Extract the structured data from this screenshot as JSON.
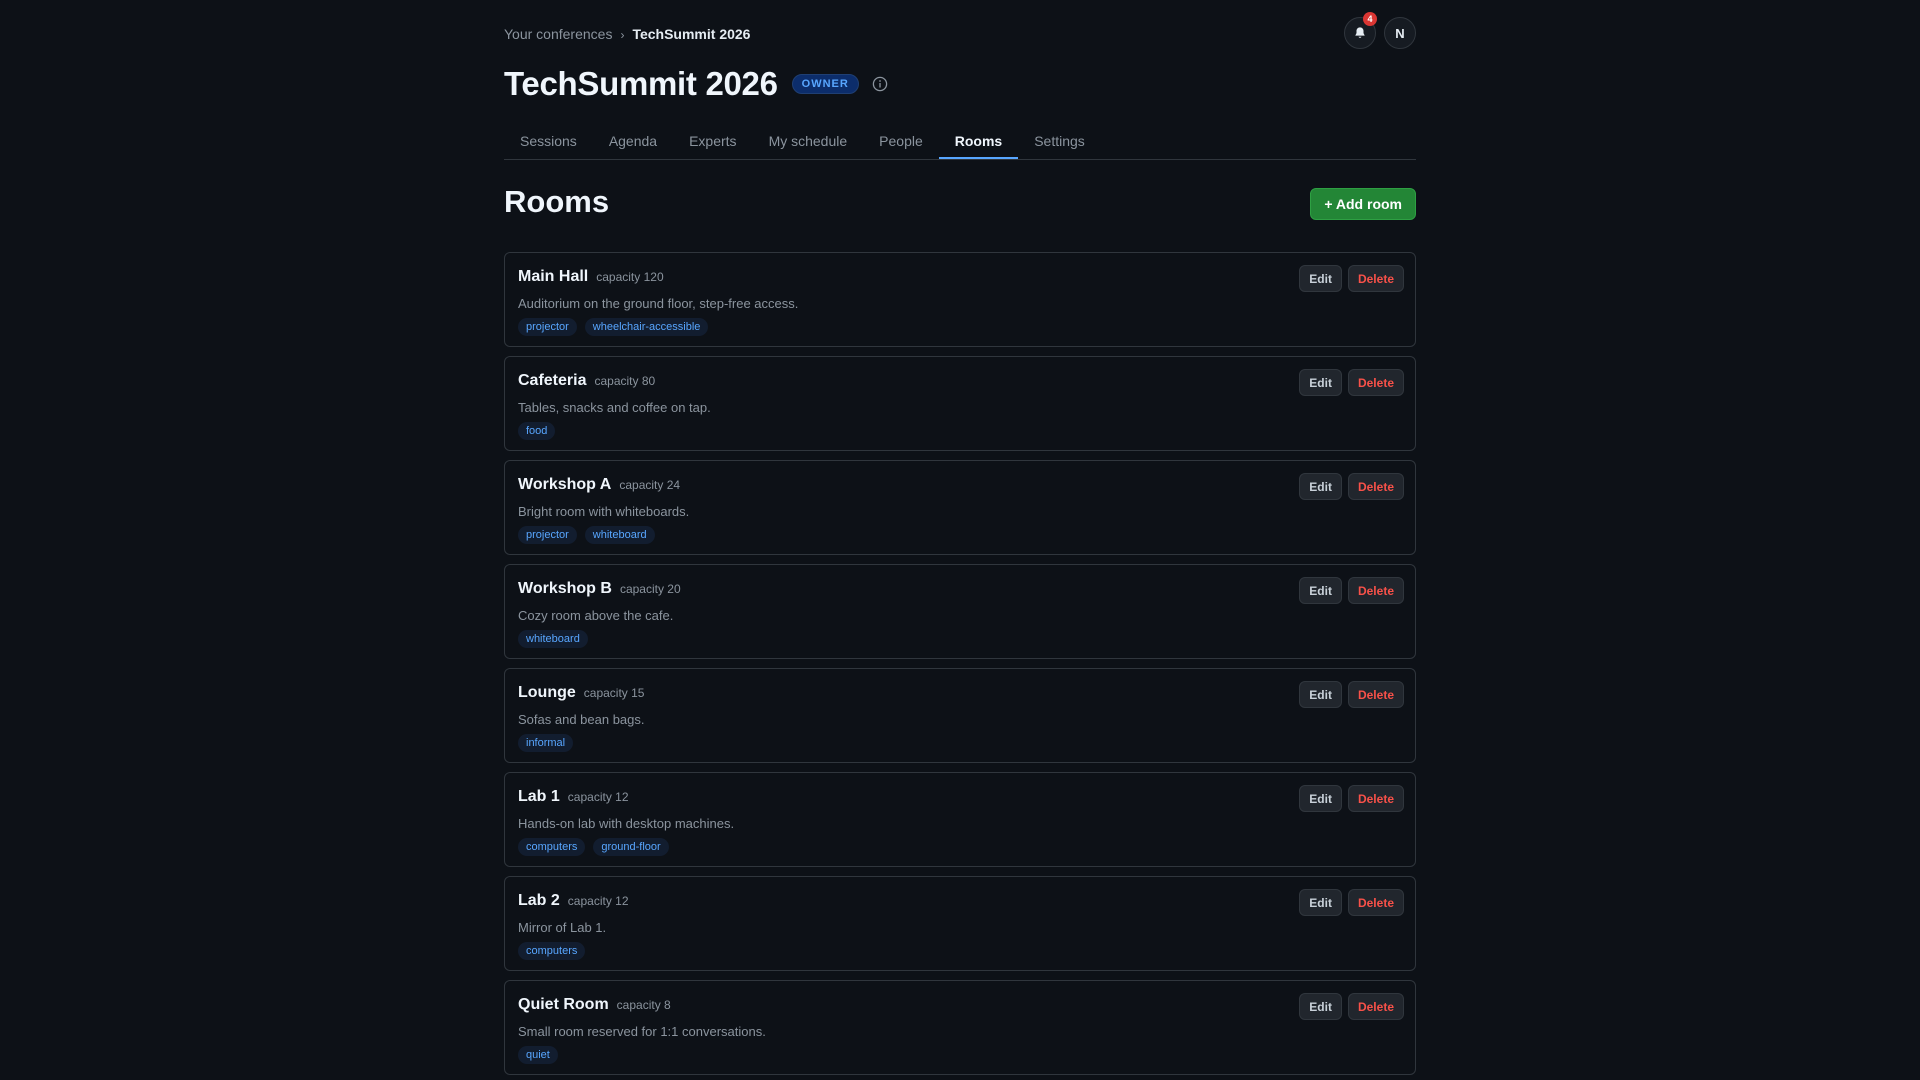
{
  "breadcrumb": {
    "parent": "Your conferences",
    "separator": "›",
    "current": "TechSummit 2026"
  },
  "header": {
    "notifications_count": "4",
    "avatar_initial": "N"
  },
  "conference": {
    "title": "TechSummit 2026",
    "role_badge": "OWNER"
  },
  "tabs": [
    {
      "label": "Sessions",
      "active": false
    },
    {
      "label": "Agenda",
      "active": false
    },
    {
      "label": "Experts",
      "active": false
    },
    {
      "label": "My schedule",
      "active": false
    },
    {
      "label": "People",
      "active": false
    },
    {
      "label": "Rooms",
      "active": true
    },
    {
      "label": "Settings",
      "active": false
    }
  ],
  "rooms_page": {
    "title": "Rooms",
    "add_button": "+ Add room",
    "edit_label": "Edit",
    "delete_label": "Delete"
  },
  "rooms": [
    {
      "name": "Main Hall",
      "capacity": "capacity 120",
      "description": "Auditorium on the ground floor, step-free access.",
      "tags": [
        "projector",
        "wheelchair-accessible"
      ]
    },
    {
      "name": "Cafeteria",
      "capacity": "capacity 80",
      "description": "Tables, snacks and coffee on tap.",
      "tags": [
        "food"
      ]
    },
    {
      "name": "Workshop A",
      "capacity": "capacity 24",
      "description": "Bright room with whiteboards.",
      "tags": [
        "projector",
        "whiteboard"
      ]
    },
    {
      "name": "Workshop B",
      "capacity": "capacity 20",
      "description": "Cozy room above the cafe.",
      "tags": [
        "whiteboard"
      ]
    },
    {
      "name": "Lounge",
      "capacity": "capacity 15",
      "description": "Sofas and bean bags.",
      "tags": [
        "informal"
      ]
    },
    {
      "name": "Lab 1",
      "capacity": "capacity 12",
      "description": "Hands-on lab with desktop machines.",
      "tags": [
        "computers",
        "ground-floor"
      ]
    },
    {
      "name": "Lab 2",
      "capacity": "capacity 12",
      "description": "Mirror of Lab 1.",
      "tags": [
        "computers"
      ]
    },
    {
      "name": "Quiet Room",
      "capacity": "capacity 8",
      "description": "Small room reserved for 1:1 conversations.",
      "tags": [
        "quiet"
      ]
    }
  ],
  "colors": {
    "background": "#0d1117",
    "accent": "#58a6ff",
    "primary_button": "#238636",
    "danger": "#f85149",
    "notification": "#da3633"
  },
  "icons": {
    "notifications": "bell-icon",
    "info": "info-icon"
  }
}
